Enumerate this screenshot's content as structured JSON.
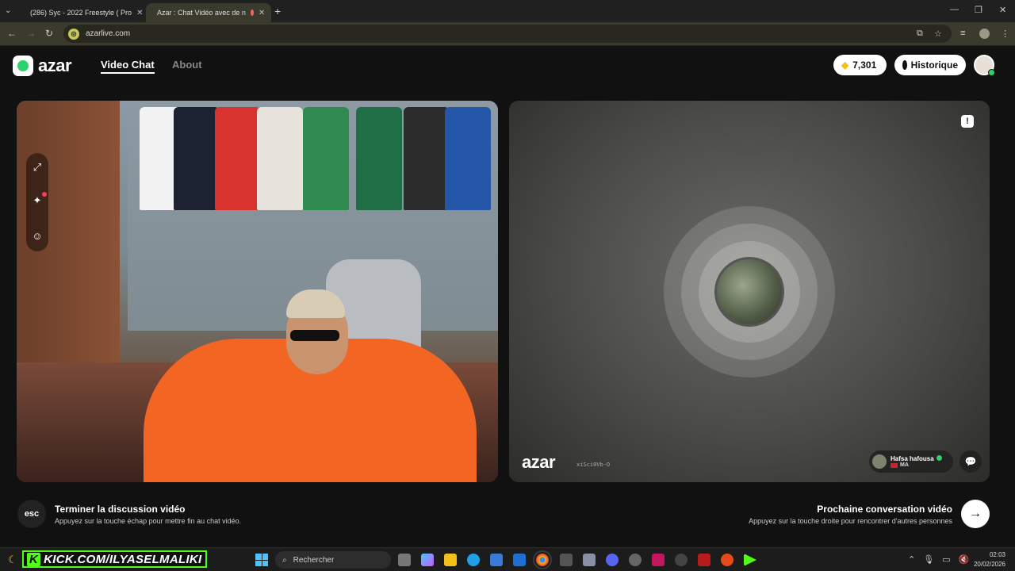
{
  "browser": {
    "tabs": [
      {
        "title": "(286) Syc - 2022 Freestyle ( Pro"
      },
      {
        "title": "Azar : Chat Vidéo avec de n"
      }
    ],
    "url": "azarlive.com"
  },
  "header": {
    "logo_text": "azar",
    "nav": [
      {
        "label": "Video Chat"
      },
      {
        "label": "About"
      }
    ],
    "gems": "7,301",
    "history_label": "Historique"
  },
  "remote": {
    "logo_text": "azar",
    "session_code": "xiSci0Vb-O",
    "peer_name": "Hafsa hafousa",
    "peer_country": "MA"
  },
  "actions": {
    "esc_key": "esc",
    "end_title": "Terminer la discussion vidéo",
    "end_subtitle": "Appuyez sur la touche échap pour mettre fin au chat vidéo.",
    "next_title": "Prochaine conversation vidéo",
    "next_subtitle": "Appuyez sur la touche droite pour rencontrer d'autres personnes"
  },
  "taskbar": {
    "overlay_text": "KICK.COM/ILYASELMALIKI",
    "search_placeholder": "Rechercher",
    "time": "02:03",
    "date": "20/02/2026"
  },
  "colors": {
    "brand_green": "#2bd46b",
    "kick_green": "#53fc18",
    "gem_gold": "#f2c21b"
  }
}
